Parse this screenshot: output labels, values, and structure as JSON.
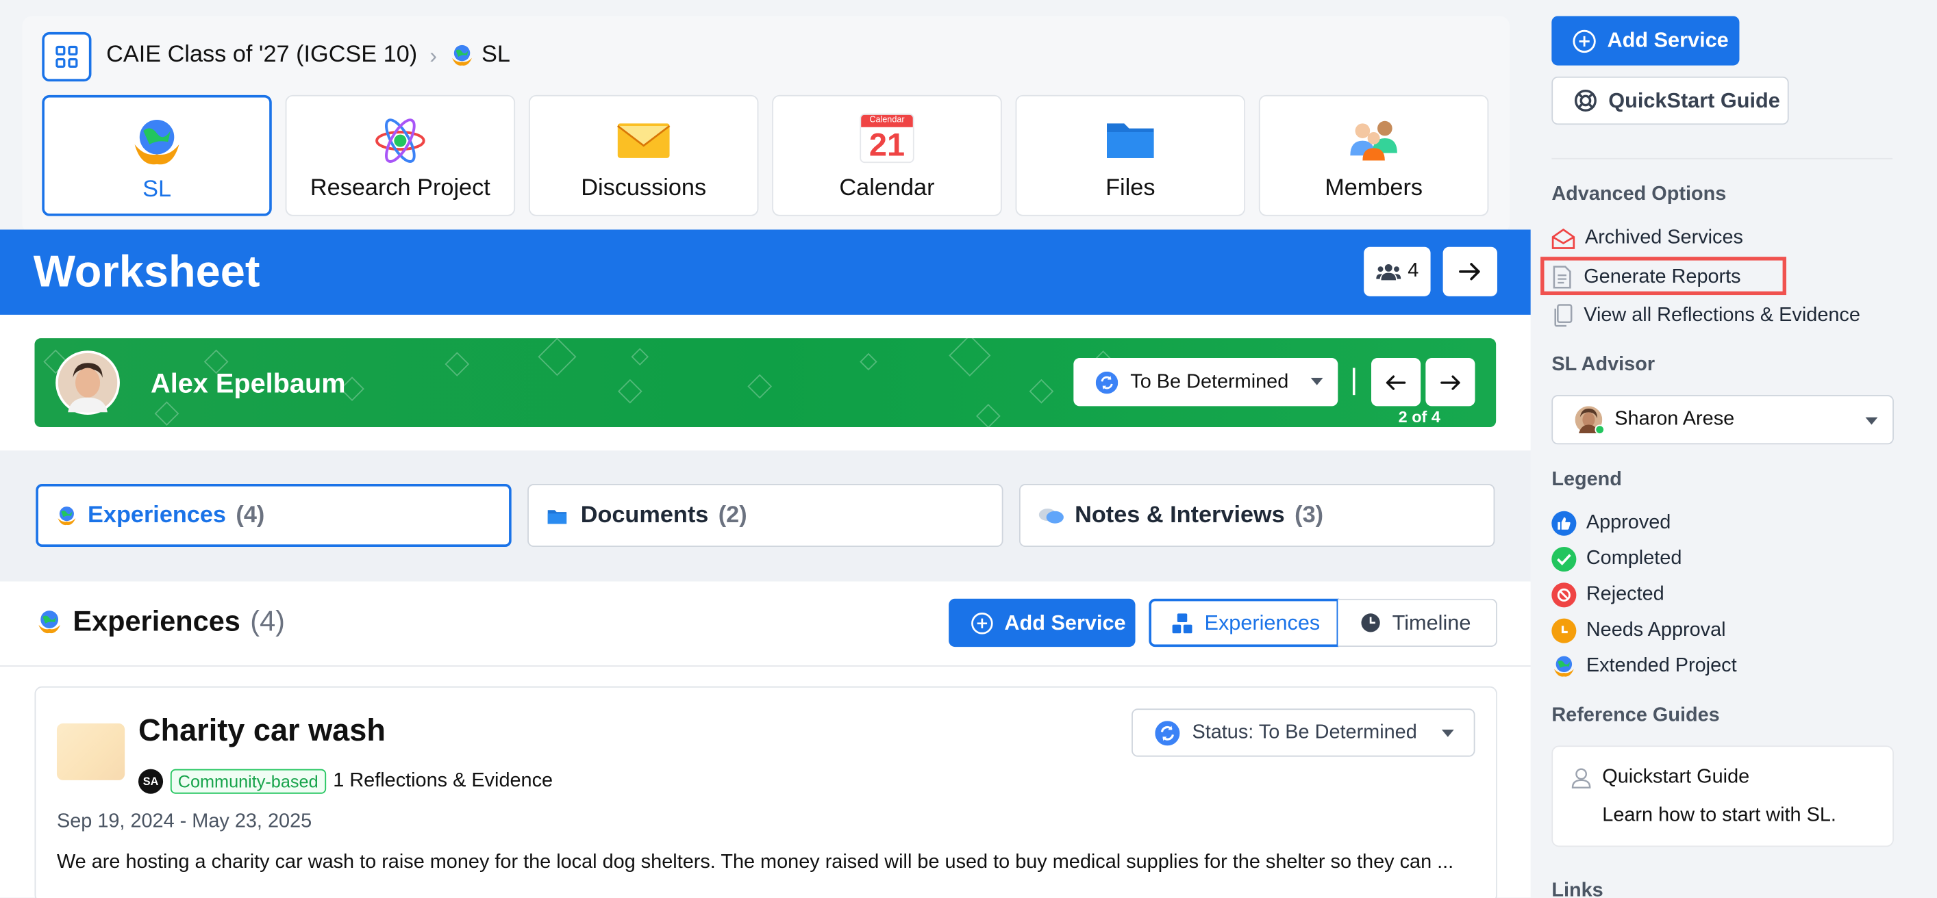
{
  "breadcrumb": {
    "group": "CAIE Class of '27 (IGCSE 10)",
    "current": "SL"
  },
  "tiles": [
    {
      "label": "SL",
      "icon": "globe-hands-icon",
      "active": true
    },
    {
      "label": "Research Project",
      "icon": "atom-icon"
    },
    {
      "label": "Discussions",
      "icon": "envelope-icon"
    },
    {
      "label": "Calendar",
      "icon": "calendar-icon",
      "cal_month": "Calendar",
      "cal_day": "21"
    },
    {
      "label": "Files",
      "icon": "folder-icon"
    },
    {
      "label": "Members",
      "icon": "people-icon"
    }
  ],
  "worksheet": {
    "title": "Worksheet",
    "member_count": "4"
  },
  "student": {
    "name": "Alex Epelbaum",
    "status": "To Be Determined",
    "pager": "2 of 4"
  },
  "tabs": [
    {
      "label": "Experiences",
      "count": "(4)"
    },
    {
      "label": "Documents",
      "count": "(2)"
    },
    {
      "label": "Notes & Interviews",
      "count": "(3)"
    }
  ],
  "experiences": {
    "title": "Experiences",
    "count": "(4)",
    "add_label": "Add Service",
    "view_experiences": "Experiences",
    "view_timeline": "Timeline"
  },
  "item": {
    "title": "Charity car wash",
    "avatar_initials": "SA",
    "tag": "Community-based",
    "reflections": "1 Reflections & Evidence",
    "dates": "Sep 19, 2024 - May 23, 2025",
    "status": "Status: To Be Determined",
    "description": "We are hosting a charity car wash to raise money for the local dog shelters. The money raised will be used to buy medical supplies for the shelter so they can ..."
  },
  "sidebar": {
    "add_service": "Add Service",
    "quickstart": "QuickStart Guide",
    "advanced_heading": "Advanced Options",
    "advanced": [
      "Archived Services",
      "Generate Reports",
      "View all Reflections & Evidence"
    ],
    "advisor_heading": "SL Advisor",
    "advisor": "Sharon Arese",
    "legend_heading": "Legend",
    "legend": [
      "Approved",
      "Completed",
      "Rejected",
      "Needs Approval",
      "Extended Project"
    ],
    "guides_heading": "Reference Guides",
    "guide_title": "Quickstart Guide",
    "guide_desc": "Learn how to start with SL.",
    "links_heading": "Links"
  },
  "colors": {
    "primary": "#1a73e8",
    "green": "#16a34a",
    "highlight": "#f0524f"
  }
}
